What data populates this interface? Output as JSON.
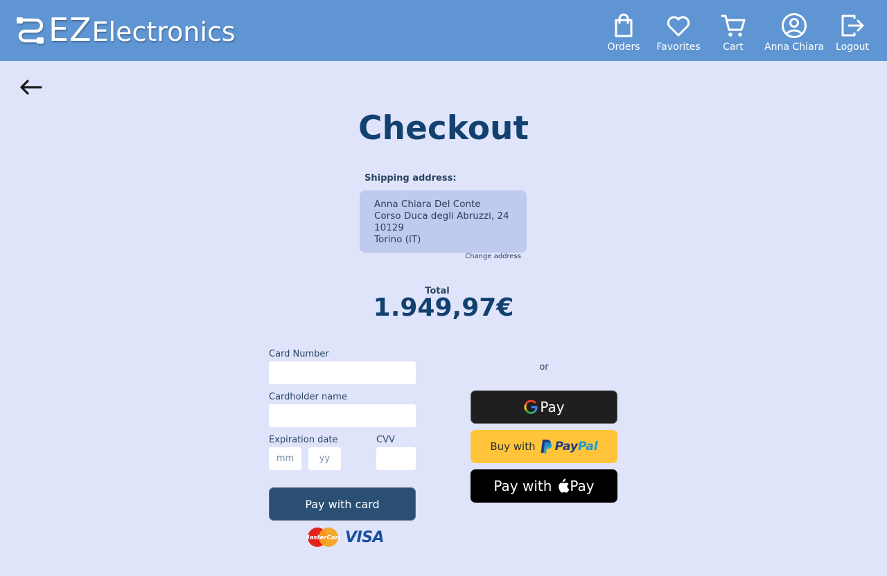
{
  "header": {
    "logo_ez": "EZ",
    "logo_rest": "Electronics",
    "nav": [
      {
        "label": "Orders",
        "icon": "shopping-bag-icon"
      },
      {
        "label": "Favorites",
        "icon": "heart-icon"
      },
      {
        "label": "Cart",
        "icon": "cart-icon"
      },
      {
        "label": "Anna Chiara",
        "icon": "user-circle-icon"
      },
      {
        "label": "Logout",
        "icon": "logout-icon"
      }
    ]
  },
  "page": {
    "title": "Checkout"
  },
  "shipping": {
    "label": "Shipping address:",
    "lines": [
      "Anna Chiara Del Conte",
      "Corso Duca degli Abruzzi, 24",
      "10129",
      "Torino (IT)"
    ],
    "change_label": "Change address"
  },
  "total": {
    "label": "Total",
    "value": "1.949,97€"
  },
  "card_form": {
    "card_number_label": "Card Number",
    "card_number_value": "",
    "cardholder_label": "Cardholder name",
    "cardholder_value": "",
    "expiration_label": "Expiration date",
    "month_placeholder": "mm",
    "year_placeholder": "yy",
    "cvv_label": "CVV",
    "cvv_value": "",
    "pay_button": "Pay with card",
    "card_brands": [
      "MasterCard",
      "VISA"
    ]
  },
  "alternatives": {
    "or_label": "or",
    "gpay_text": "Pay",
    "paypal_prefix": "Buy with",
    "paypal_pay": "Pay",
    "paypal_pal": "Pal",
    "applepay_prefix": "Pay with",
    "applepay_text": "Pay"
  },
  "colors": {
    "header": "#5f95d2",
    "background": "#dfe4fb",
    "title": "#13416f",
    "pay_button": "#2a4f73",
    "paypal": "#ffc43a"
  }
}
